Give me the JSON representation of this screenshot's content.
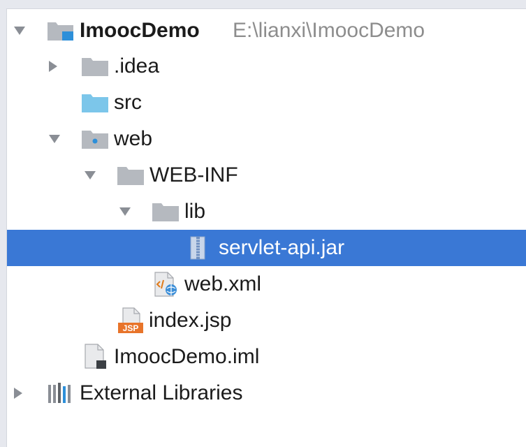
{
  "tree": {
    "project": {
      "name": "ImoocDemo",
      "path": "E:\\lianxi\\ImoocDemo"
    },
    "items": [
      {
        "label": ".idea"
      },
      {
        "label": "src"
      },
      {
        "label": "web"
      },
      {
        "label": "WEB-INF"
      },
      {
        "label": "lib"
      },
      {
        "label": "servlet-api.jar"
      },
      {
        "label": "web.xml"
      },
      {
        "label": "index.jsp"
      },
      {
        "label": "ImoocDemo.iml"
      },
      {
        "label": "External Libraries"
      }
    ],
    "jsp_badge": "JSP"
  },
  "colors": {
    "selection": "#3a78d5",
    "folder": "#b5b9bf",
    "source_folder": "#7cc6ea",
    "path_hint": "#8d8d8d"
  }
}
